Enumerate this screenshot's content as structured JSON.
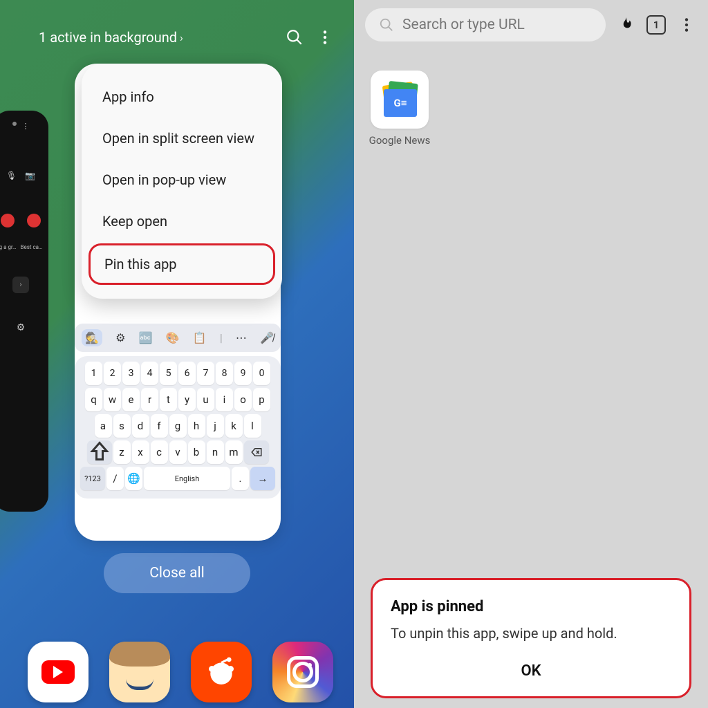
{
  "left": {
    "header": {
      "active_label": "1 active in background"
    },
    "menu": {
      "items": [
        "App info",
        "Open in split screen view",
        "Open in pop-up view",
        "Keep open",
        "Pin this app"
      ],
      "highlighted_index": 4
    },
    "prev_card": {
      "labels": [
        "g a gr…",
        "Best ca…"
      ]
    },
    "keyboard": {
      "row_nums": [
        "1",
        "2",
        "3",
        "4",
        "5",
        "6",
        "7",
        "8",
        "9",
        "0"
      ],
      "row_q": [
        "q",
        "w",
        "e",
        "r",
        "t",
        "y",
        "u",
        "i",
        "o",
        "p"
      ],
      "row_a": [
        "a",
        "s",
        "d",
        "f",
        "g",
        "h",
        "j",
        "k",
        "l"
      ],
      "row_z": [
        "z",
        "x",
        "c",
        "v",
        "b",
        "n",
        "m"
      ],
      "sym_key": "?123",
      "slash_key": "/",
      "lang_label": "English",
      "dot_key": "."
    },
    "close_all": "Close all",
    "dock": [
      "youtube",
      "amazon",
      "reddit",
      "instagram"
    ]
  },
  "right": {
    "search_placeholder": "Search or type URL",
    "tab_count": "1",
    "shortcut": {
      "label": "Google News"
    },
    "toast": {
      "title": "App is pinned",
      "body": "To unpin this app, swipe up and hold.",
      "ok": "OK"
    }
  }
}
